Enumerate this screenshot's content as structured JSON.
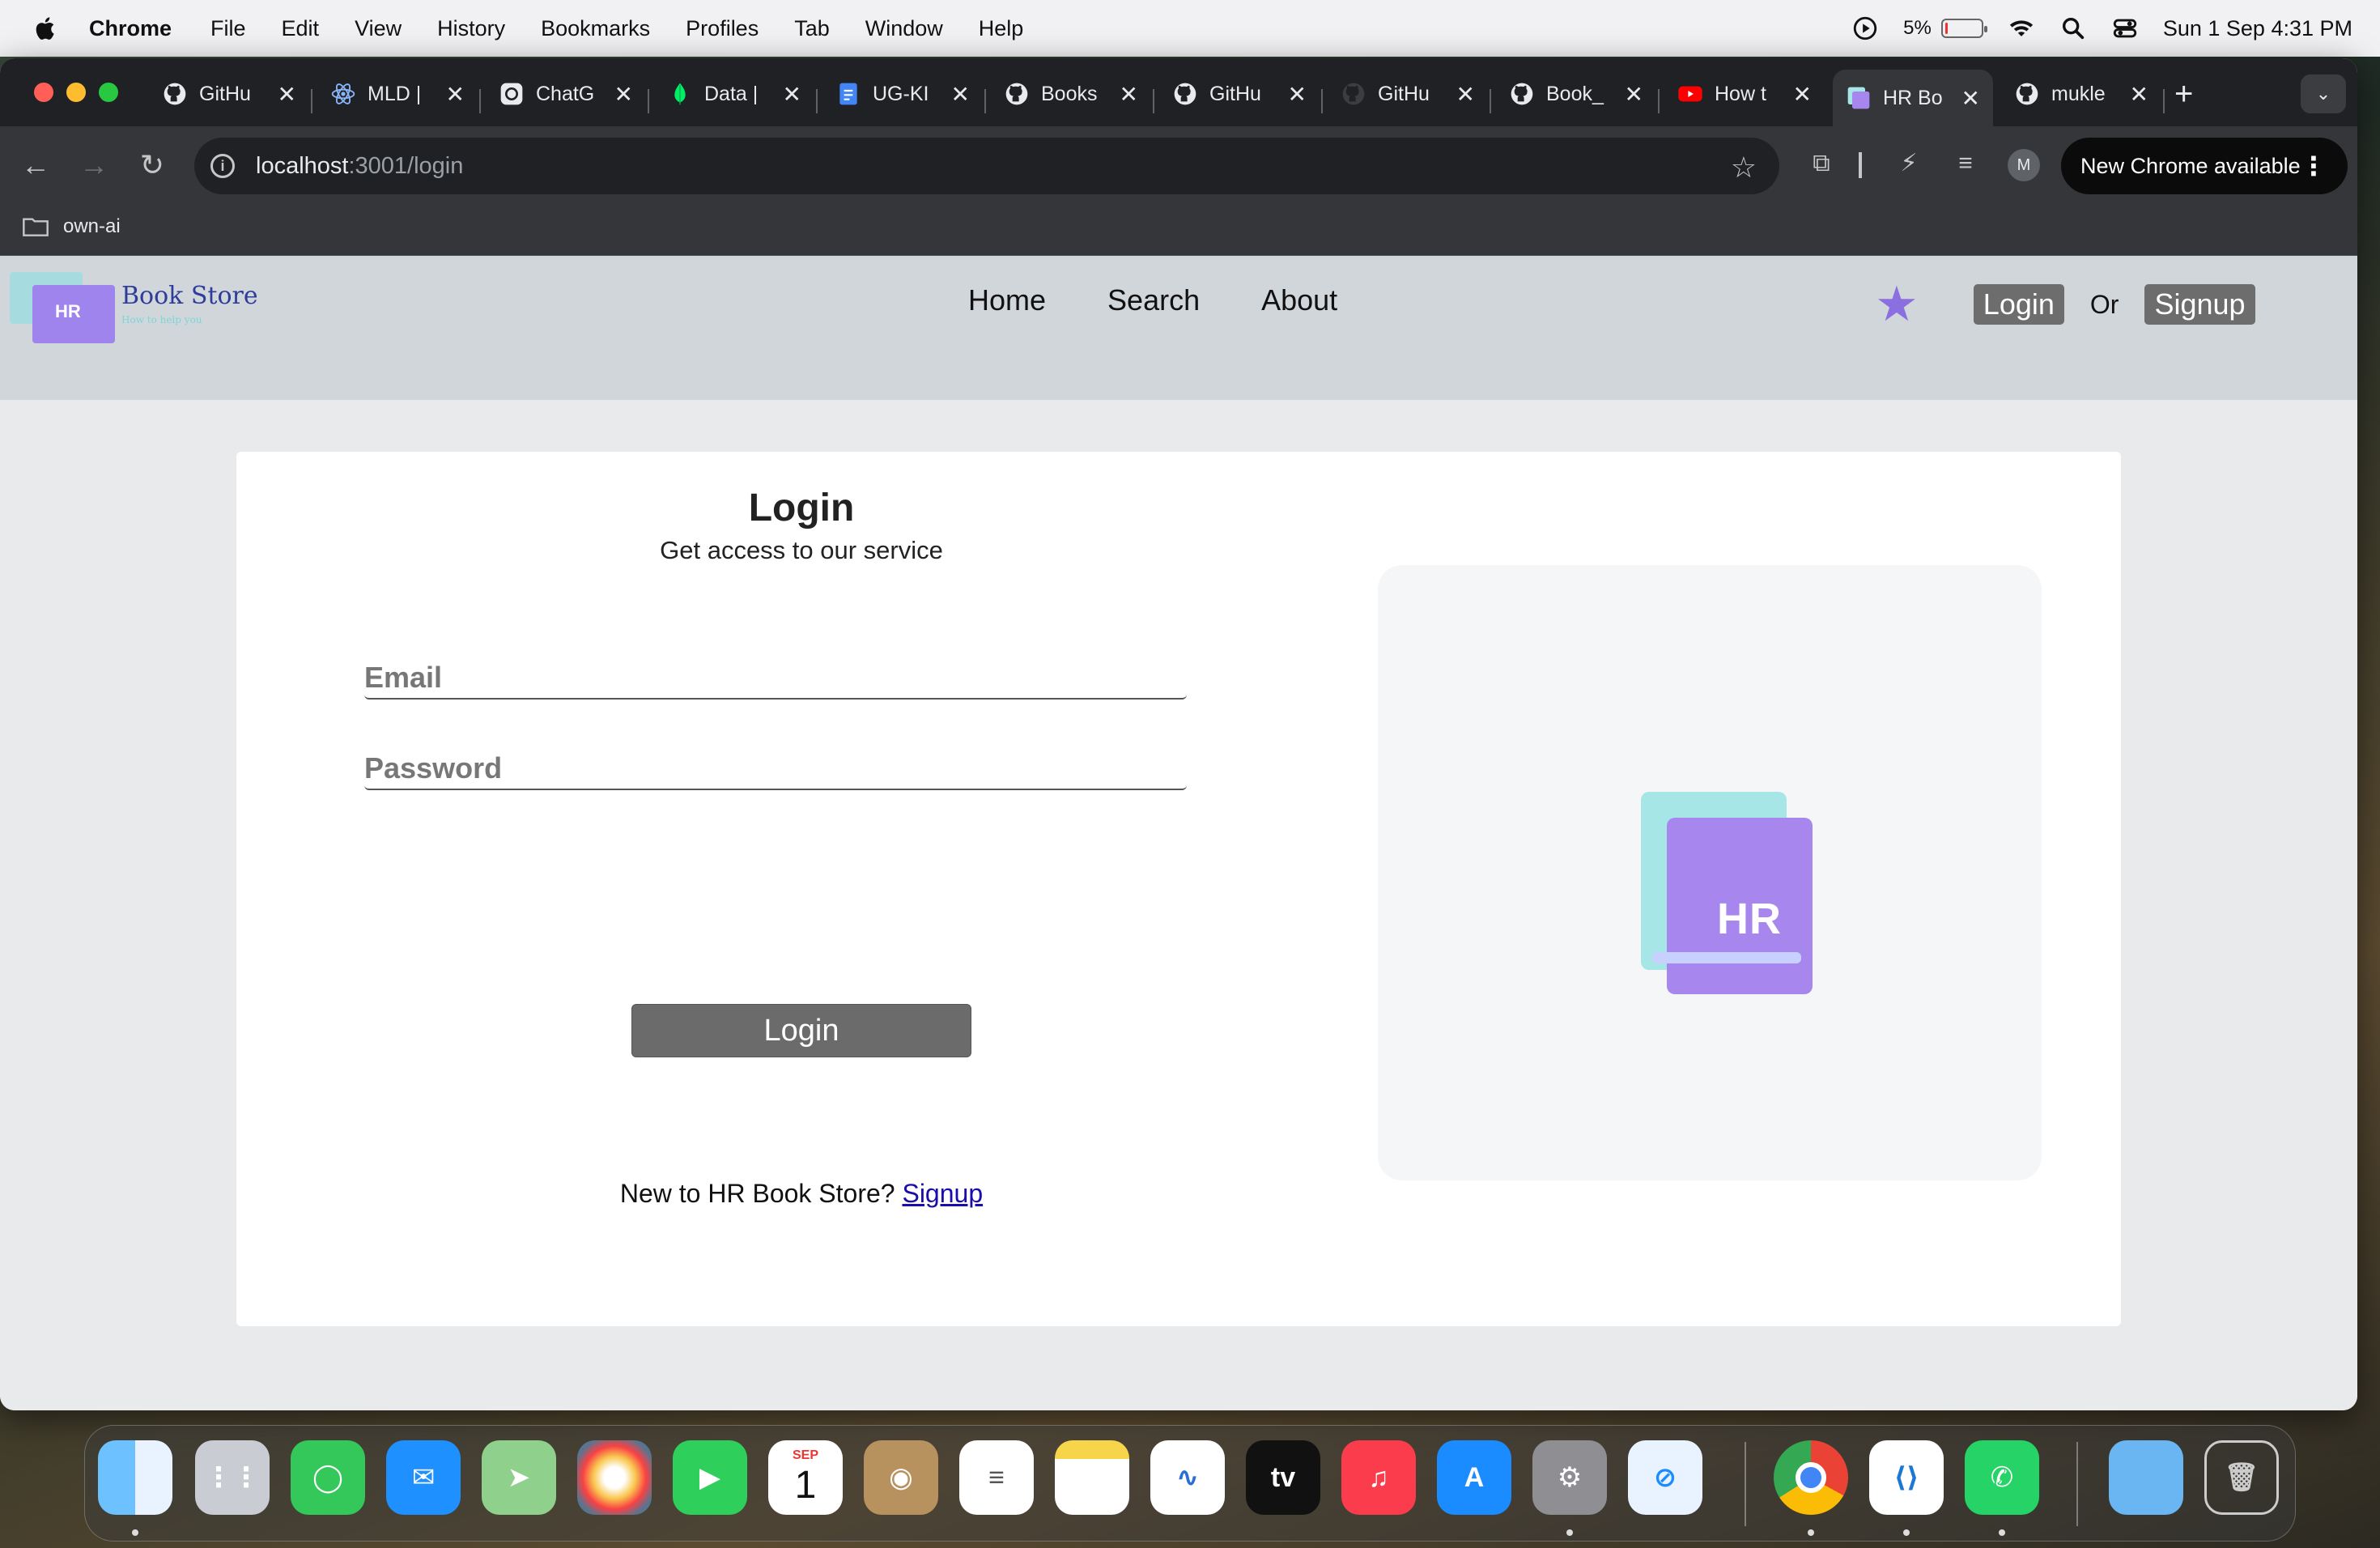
{
  "menubar": {
    "app_name": "Chrome",
    "items": [
      "File",
      "Edit",
      "View",
      "History",
      "Bookmarks",
      "Profiles",
      "Tab",
      "Window",
      "Help"
    ],
    "battery": "5%",
    "datetime": "Sun 1 Sep  4:31 PM"
  },
  "tabs": [
    {
      "title": "GitHu",
      "icon": "github-icon"
    },
    {
      "title": "MLD |",
      "icon": "react-icon"
    },
    {
      "title": "ChatG",
      "icon": "chatgpt-icon"
    },
    {
      "title": "Data |",
      "icon": "mongodb-leaf-icon"
    },
    {
      "title": "UG-KI",
      "icon": "google-docs-icon"
    },
    {
      "title": "Books",
      "icon": "github-icon"
    },
    {
      "title": "GitHu",
      "icon": "github-icon"
    },
    {
      "title": "GitHu",
      "icon": "github-icon"
    },
    {
      "title": "Book_",
      "icon": "github-icon"
    },
    {
      "title": "How t",
      "icon": "youtube-icon"
    },
    {
      "title": "HR Bo",
      "icon": "hr-bookstore-icon",
      "active": true
    },
    {
      "title": "mukle",
      "icon": "github-icon"
    }
  ],
  "omnibox": {
    "host": "localhost",
    "path": ":3001/login"
  },
  "update_button": "New Chrome available",
  "profile_initial": "M",
  "bookmarks": [
    {
      "label": "own-ai"
    }
  ],
  "site": {
    "brand": "Book Store",
    "tagline": "How to help you",
    "logo_text": "HR",
    "nav": [
      "Home",
      "Search",
      "About"
    ],
    "login_button": "Login",
    "or_text": "Or",
    "signup_button": "Signup"
  },
  "login_form": {
    "title": "Login",
    "subtitle": "Get access to our service",
    "email_placeholder": "Email",
    "password_placeholder": "Password",
    "submit": "Login",
    "signup_prompt": "New to HR Book Store? ",
    "signup_link": "Signup",
    "illustration_text": "HR"
  },
  "dock": {
    "apps": [
      "Finder",
      "Launchpad",
      "Messages",
      "Mail",
      "Maps",
      "Photos",
      "FaceTime",
      "Calendar",
      "Contacts",
      "Reminders",
      "Notes",
      "Freeform",
      "TV",
      "Music",
      "App Store",
      "System Settings",
      "Safari",
      "Chrome",
      "VS Code",
      "WhatsApp",
      "Downloads",
      "Trash"
    ],
    "calendar_month": "SEP",
    "calendar_day": "1",
    "tv_label": "tv"
  },
  "colors": {
    "accent_purple": "#9e84ec",
    "accent_cyan": "#9fdde0",
    "nav_bg": "#d1d6da",
    "button_gray": "#6b6b6b",
    "link_blue": "#1a0dab"
  }
}
